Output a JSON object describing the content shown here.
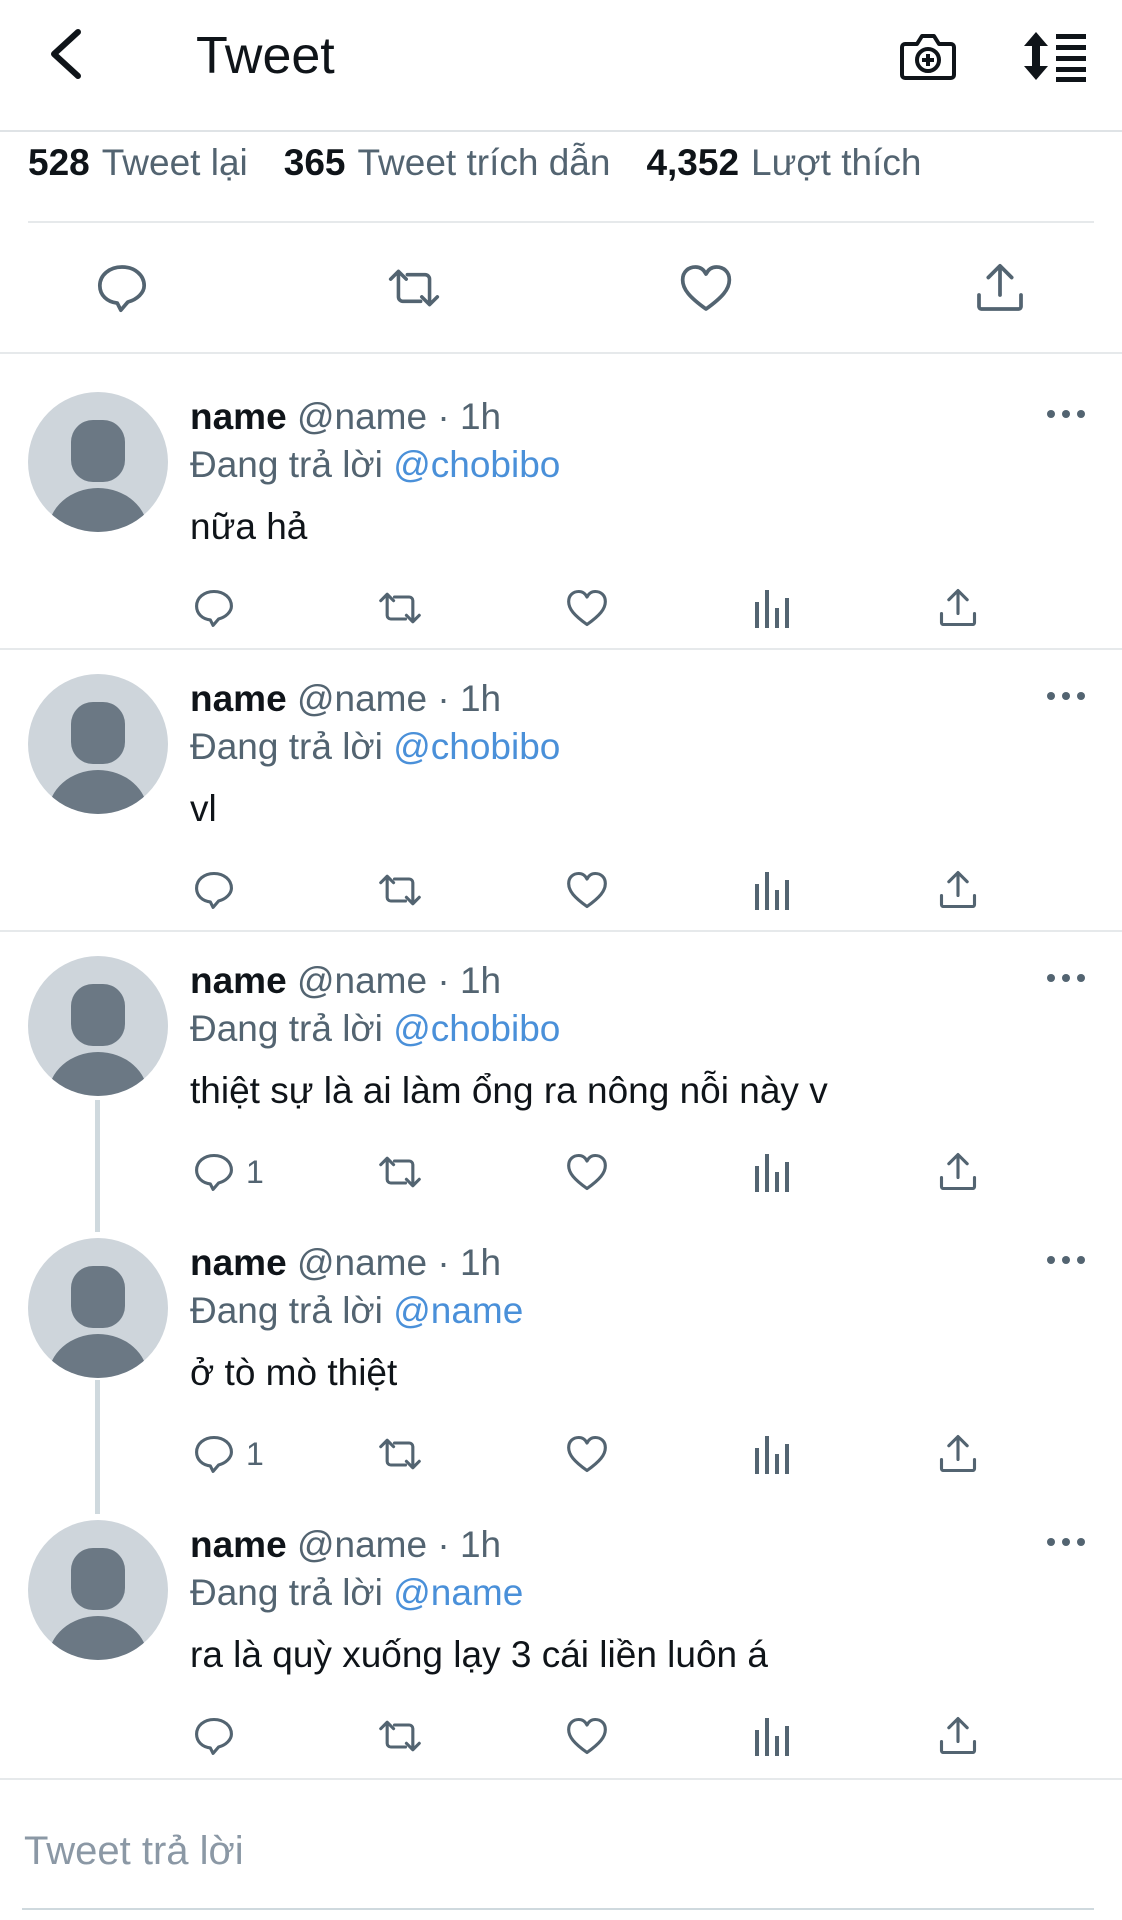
{
  "header": {
    "title": "Tweet",
    "back_icon": "chevron-left-icon",
    "camera_icon": "camera-add-icon",
    "sort_icon": "sort-lines-icon"
  },
  "stats": {
    "retweets_count": "528",
    "retweets_label": "Tweet lại",
    "quotes_count": "365",
    "quotes_label": "Tweet trích dẫn",
    "likes_count": "4,352",
    "likes_label": "Lượt thích"
  },
  "colors": {
    "text": "#0f1419",
    "secondary": "#536471",
    "mention": "#4a90d9",
    "divider": "#e6e9eb",
    "avatar_bg": "#ced5db",
    "avatar_fg": "#6b7884"
  },
  "replies": [
    {
      "name": "name",
      "handle": "@name",
      "dot": "·",
      "time": "1h",
      "replying_label": "Đang trả lời",
      "mention": "@chobibo",
      "text": "nữa hả",
      "reply_count": ""
    },
    {
      "name": "name",
      "handle": "@name",
      "dot": "·",
      "time": "1h",
      "replying_label": "Đang trả lời",
      "mention": "@chobibo",
      "text": "vl",
      "reply_count": ""
    },
    {
      "name": "name",
      "handle": "@name",
      "dot": "·",
      "time": "1h",
      "replying_label": "Đang trả lời",
      "mention": "@chobibo",
      "text": "thiệt sự là ai làm ổng ra nông nỗi này v",
      "reply_count": "1"
    },
    {
      "name": "name",
      "handle": "@name",
      "dot": "·",
      "time": "1h",
      "replying_label": "Đang trả lời",
      "mention": "@name",
      "text": "ở tò mò thiệt",
      "reply_count": "1"
    },
    {
      "name": "name",
      "handle": "@name",
      "dot": "·",
      "time": "1h",
      "replying_label": "Đang trả lời",
      "mention": "@name",
      "text": "ra là quỳ xuống lạy 3 cái liền luôn á",
      "reply_count": ""
    }
  ],
  "compose": {
    "placeholder": "Tweet trả lời",
    "value": ""
  }
}
